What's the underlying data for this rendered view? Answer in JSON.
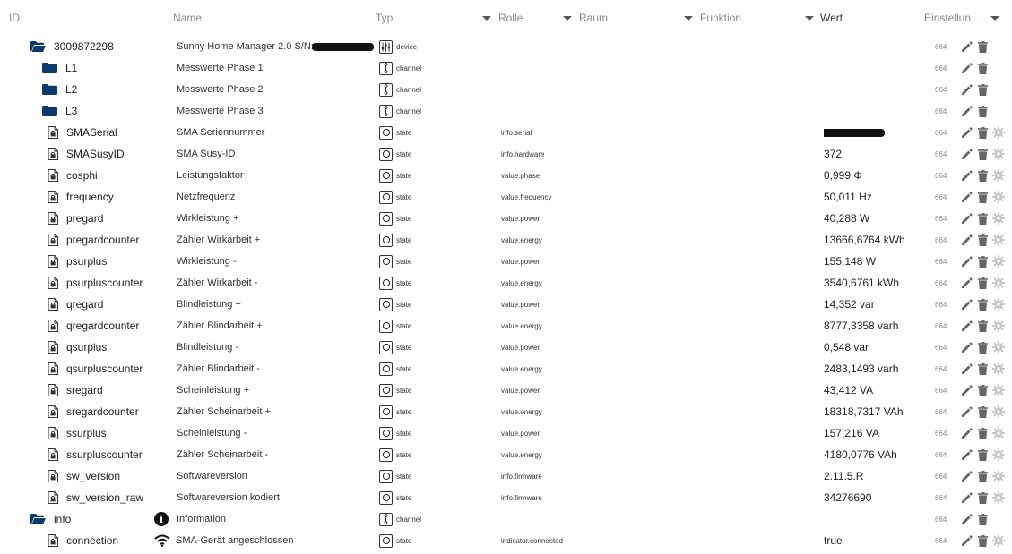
{
  "header": {
    "id": "ID",
    "name": "Name",
    "type": "Typ",
    "role": "Rolle",
    "room": "Raum",
    "function": "Funktion",
    "value": "Wert",
    "settings": "Einstellun..."
  },
  "rows": [
    {
      "id": "3009872298",
      "kind": "folder-open",
      "name": "Sunny Home Manager 2.0 S/N:",
      "type": "device",
      "type_icon": "device-icon",
      "role": "",
      "value": "",
      "perm": "664",
      "redact_name": true
    },
    {
      "id": "L1",
      "kind": "folder",
      "name": "Messwerte Phase 1",
      "type": "channel",
      "type_icon": "channel-icon",
      "role": "",
      "value": "",
      "perm": "664"
    },
    {
      "id": "L2",
      "kind": "folder",
      "name": "Messwerte Phase 2",
      "type": "channel",
      "type_icon": "channel-icon",
      "role": "",
      "value": "",
      "perm": "664"
    },
    {
      "id": "L3",
      "kind": "folder",
      "name": "Messwerte Phase 3",
      "type": "channel",
      "type_icon": "channel-icon",
      "role": "",
      "value": "",
      "perm": "664"
    },
    {
      "id": "SMASerial",
      "kind": "file",
      "name": "SMA Seriennummer",
      "type": "state",
      "type_icon": "state-icon",
      "role": "info.serial",
      "value": "",
      "perm": "664",
      "redact_value": true
    },
    {
      "id": "SMASusyID",
      "kind": "file",
      "name": "SMA Susy-ID",
      "type": "state",
      "type_icon": "state-icon",
      "role": "info.hardware",
      "value": "372",
      "perm": "664"
    },
    {
      "id": "cosphi",
      "kind": "file",
      "name": "Leistungsfaktor",
      "type": "state",
      "type_icon": "state-icon",
      "role": "value.phase",
      "value": "0,999 Φ",
      "perm": "664"
    },
    {
      "id": "frequency",
      "kind": "file",
      "name": "Netzfrequenz",
      "type": "state",
      "type_icon": "state-icon",
      "role": "value.frequency",
      "value": "50,011 Hz",
      "perm": "664"
    },
    {
      "id": "pregard",
      "kind": "file",
      "name": "Wirkleistung +",
      "type": "state",
      "type_icon": "state-icon",
      "role": "value.power",
      "value": "40,288 W",
      "perm": "664"
    },
    {
      "id": "pregardcounter",
      "kind": "file",
      "name": "Zähler Wirkarbeit +",
      "type": "state",
      "type_icon": "state-icon",
      "role": "value.energy",
      "value": "13666,6764 kWh",
      "perm": "664"
    },
    {
      "id": "psurplus",
      "kind": "file",
      "name": "Wirkleistung -",
      "type": "state",
      "type_icon": "state-icon",
      "role": "value.power",
      "value": "155,148 W",
      "perm": "664"
    },
    {
      "id": "psurpluscounter",
      "kind": "file",
      "name": "Zähler Wirkarbeit -",
      "type": "state",
      "type_icon": "state-icon",
      "role": "value.energy",
      "value": "3540,6761 kWh",
      "perm": "664"
    },
    {
      "id": "qregard",
      "kind": "file",
      "name": "Blindleistung +",
      "type": "state",
      "type_icon": "state-icon",
      "role": "value.power",
      "value": "14,352 var",
      "perm": "664"
    },
    {
      "id": "qregardcounter",
      "kind": "file",
      "name": "Zähler Blindarbeit +",
      "type": "state",
      "type_icon": "state-icon",
      "role": "value.energy",
      "value": "8777,3358 varh",
      "perm": "664"
    },
    {
      "id": "qsurplus",
      "kind": "file",
      "name": "Blindleistung -",
      "type": "state",
      "type_icon": "state-icon",
      "role": "value.power",
      "value": "0,548 var",
      "perm": "664"
    },
    {
      "id": "qsurpluscounter",
      "kind": "file",
      "name": "Zähler Blindarbeit -",
      "type": "state",
      "type_icon": "state-icon",
      "role": "value.energy",
      "value": "2483,1493 varh",
      "perm": "664"
    },
    {
      "id": "sregard",
      "kind": "file",
      "name": "Scheinleistung +",
      "type": "state",
      "type_icon": "state-icon",
      "role": "value.power",
      "value": "43,412 VA",
      "perm": "664"
    },
    {
      "id": "sregardcounter",
      "kind": "file",
      "name": "Zähler Scheinarbeit +",
      "type": "state",
      "type_icon": "state-icon",
      "role": "value.energy",
      "value": "18318,7317 VAh",
      "perm": "664"
    },
    {
      "id": "ssurplus",
      "kind": "file",
      "name": "Scheinleistung -",
      "type": "state",
      "type_icon": "state-icon",
      "role": "value.power",
      "value": "157,216 VA",
      "perm": "664"
    },
    {
      "id": "ssurpluscounter",
      "kind": "file",
      "name": "Zähler Scheinarbeit -",
      "type": "state",
      "type_icon": "state-icon",
      "role": "value.energy",
      "value": "4180,0776 VAh",
      "perm": "664"
    },
    {
      "id": "sw_version",
      "kind": "file",
      "name": "Softwareversion",
      "type": "state",
      "type_icon": "state-icon",
      "role": "info.firmware",
      "value": "2.11.5.R",
      "perm": "664"
    },
    {
      "id": "sw_version_raw",
      "kind": "file",
      "name": "Softwareversion kodiert",
      "type": "state",
      "type_icon": "state-icon",
      "role": "info.firmware",
      "value": "34276690",
      "perm": "664"
    },
    {
      "id": "info",
      "kind": "folder-open",
      "name": "Information",
      "name_icon": "info-icon",
      "type": "channel",
      "type_icon": "channel-icon",
      "role": "",
      "value": "",
      "perm": "664"
    },
    {
      "id": "connection",
      "kind": "file",
      "name": "SMA-Gerät angeschlossen",
      "name_icon": "wifi-icon",
      "type": "state",
      "type_icon": "state-icon",
      "role": "indicator.connected",
      "value": "true",
      "perm": "664"
    }
  ],
  "icons": {
    "folder": "folder-icon",
    "folder_open": "folder-open-icon",
    "file": "file-lock-icon",
    "edit": "pencil-icon",
    "delete": "trash-icon",
    "settings": "gear-icon"
  },
  "colors": {
    "folder": "#0c3a6b",
    "header_line": "#8f8f8f",
    "muted": "#8a8a8a",
    "icon_grey": "#666666",
    "gear_grey": "#c8c8c8"
  }
}
